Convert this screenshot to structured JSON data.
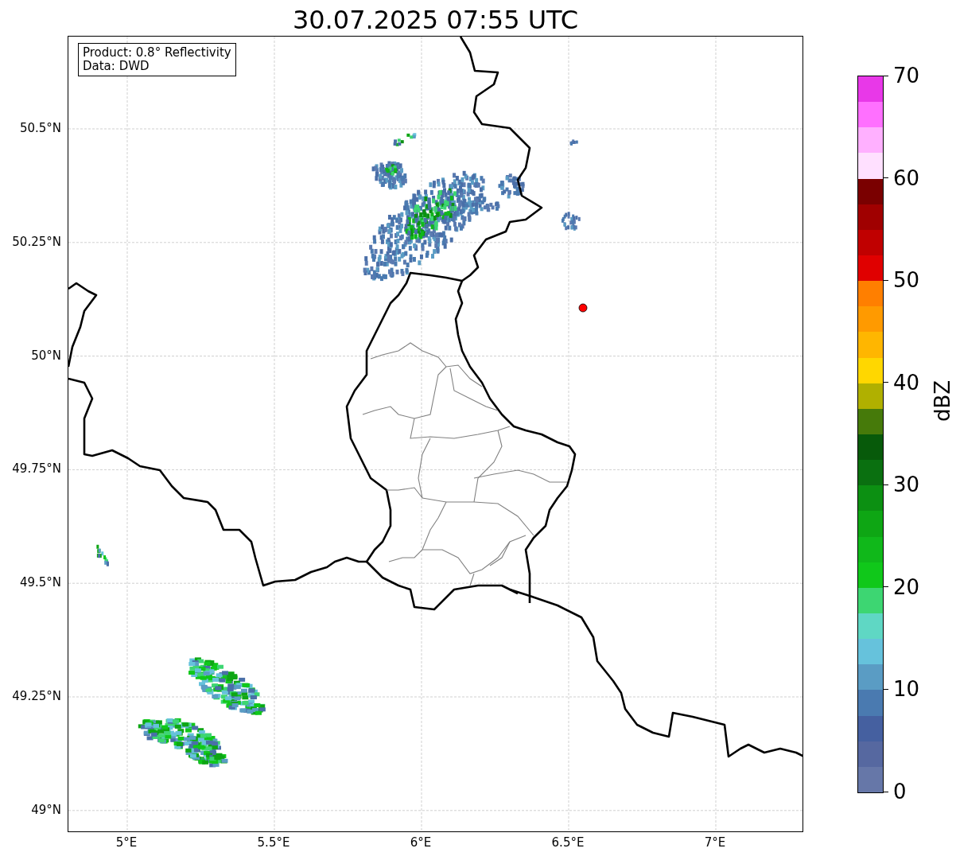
{
  "title": "30.07.2025 07:55 UTC",
  "map": {
    "info": [
      "Product: 0.8° Reflectivity",
      "Data: DWD"
    ],
    "x_ticks": [
      "5°E",
      "5.5°E",
      "6°E",
      "6.5°E",
      "7°E"
    ],
    "y_ticks": [
      "50.5°N",
      "50.25°N",
      "50°N",
      "49.75°N",
      "49.5°N",
      "49.25°N",
      "49°N"
    ]
  },
  "colorbar": {
    "label": "dBZ",
    "ticks": [
      "70",
      "60",
      "50",
      "40",
      "30",
      "20",
      "10",
      "0"
    ],
    "bins": [
      {
        "color": "#e838e8"
      },
      {
        "color": "#ff70ff"
      },
      {
        "color": "#ffb0ff"
      },
      {
        "color": "#ffe0ff"
      },
      {
        "color": "#7a0000"
      },
      {
        "color": "#a00000"
      },
      {
        "color": "#c00000"
      },
      {
        "color": "#e00000"
      },
      {
        "color": "#ff7f00"
      },
      {
        "color": "#ff9a00"
      },
      {
        "color": "#ffb600"
      },
      {
        "color": "#ffd700"
      },
      {
        "color": "#b0b000"
      },
      {
        "color": "#467a0a"
      },
      {
        "color": "#075a0a"
      },
      {
        "color": "#0a7010"
      },
      {
        "color": "#0c9012"
      },
      {
        "color": "#0ea614"
      },
      {
        "color": "#10b81a"
      },
      {
        "color": "#10c81a"
      },
      {
        "color": "#3dd672"
      },
      {
        "color": "#5fd7c4"
      },
      {
        "color": "#66c2dc"
      },
      {
        "color": "#5a9cc4"
      },
      {
        "color": "#4a7ab0"
      },
      {
        "color": "#4560a0"
      },
      {
        "color": "#5668a0"
      },
      {
        "color": "#6677a8"
      }
    ]
  }
}
